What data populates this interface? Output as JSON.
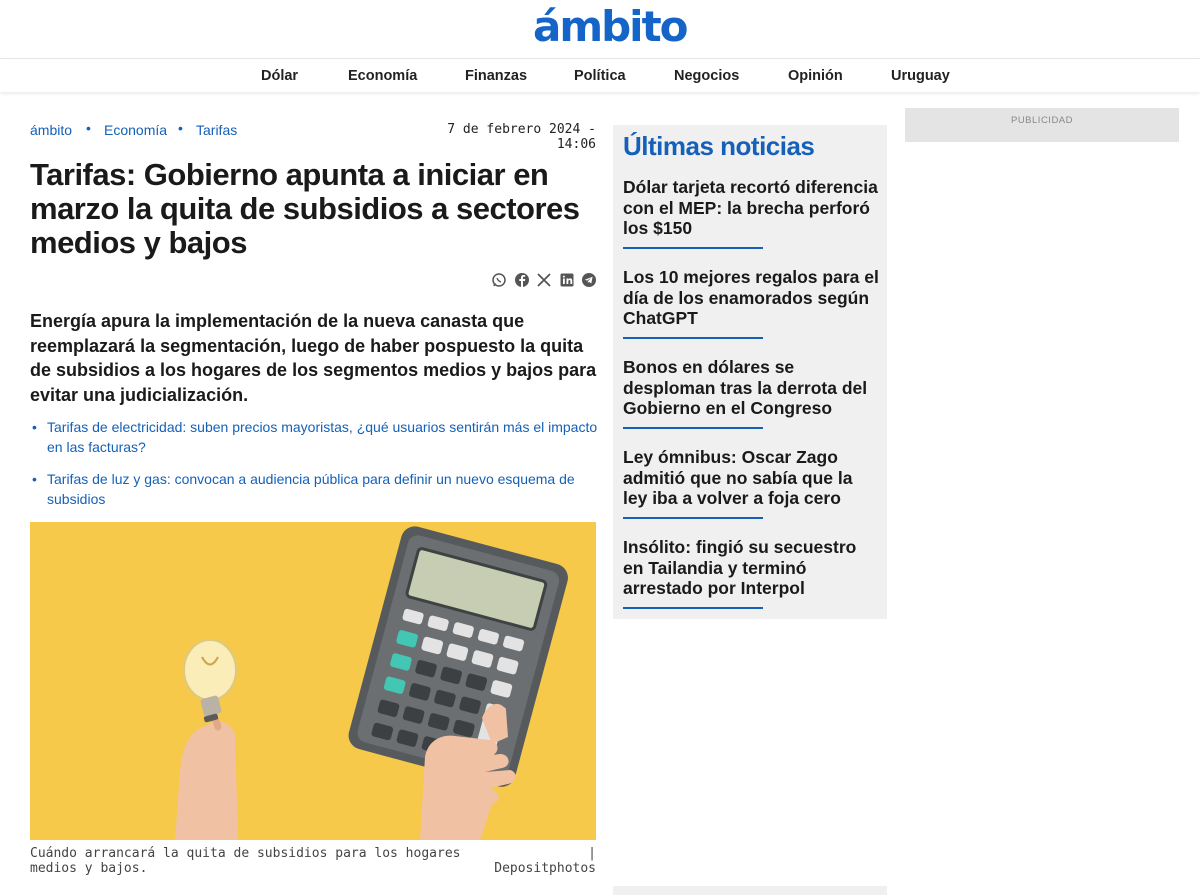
{
  "site": {
    "logo": "ámbito",
    "nav": [
      "Dólar",
      "Economía",
      "Finanzas",
      "Política",
      "Negocios",
      "Opinión",
      "Uruguay"
    ]
  },
  "article": {
    "breadcrumb": [
      "ámbito",
      "Economía",
      "Tarifas"
    ],
    "date": "7 de febrero 2024 - 14:06",
    "headline": "Tarifas: Gobierno apunta a iniciar en marzo la quita de subsidios a sectores medios y bajos",
    "share_icons": [
      "whatsapp-icon",
      "facebook-icon",
      "x-icon",
      "linkedin-icon",
      "telegram-icon"
    ],
    "lead": "Energía apura la implementación de la nueva canasta que reemplazará la segmentación, luego de haber pospuesto la quita de subsidios a los hogares de los segmentos medios y bajos para evitar una judicialización.",
    "related": [
      "Tarifas de electricidad: suben precios mayoristas, ¿qué usuarios sentirán más el impacto en las facturas?",
      "Tarifas de luz y gas: convocan a audiencia pública para definir un nuevo esquema de subsidios"
    ],
    "caption": "Cuándo arrancará la quita de subsidios para los hogares medios y bajos.",
    "credit": "| Depositphotos"
  },
  "sidebar": {
    "title": "Últimas noticias",
    "items": [
      "Dólar tarjeta recortó diferencia con el MEP: la brecha perforó los $150",
      "Los 10 mejores regalos para el día de los enamorados según ChatGPT",
      "Bonos en dólares se desploman tras la derrota del Gobierno en el Congreso",
      "Ley ómnibus: Oscar Zago admitió que no sabía que la ley iba a volver a foja cero",
      "Insólito: fingió su secuestro en Tailandia y terminó arrestado por Interpol"
    ]
  },
  "ad": {
    "label": "PUBLICIDAD"
  },
  "colors": {
    "brand": "#1560b8",
    "hero_bg": "#f6c94a",
    "sidebar_bg": "#f0f0f0"
  }
}
